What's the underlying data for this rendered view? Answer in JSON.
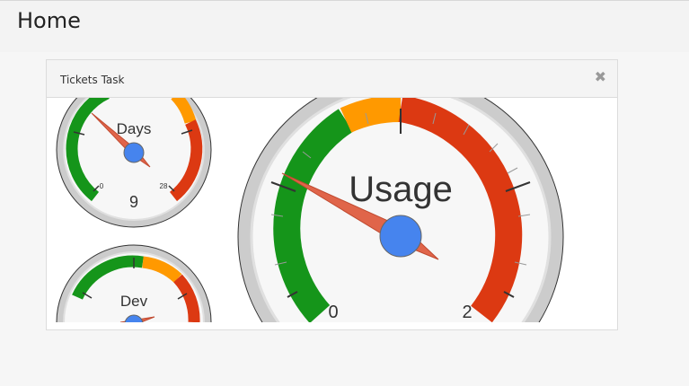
{
  "page": {
    "title": "Home"
  },
  "panel": {
    "title": "Tickets Task",
    "close_icon": "close-icon"
  },
  "gauges": {
    "days": {
      "label": "Days",
      "value": "9",
      "min": "0",
      "max": "28"
    },
    "dev": {
      "label": "Dev"
    },
    "usage": {
      "label": "Usage",
      "min": "0",
      "max": "2"
    }
  },
  "colors": {
    "green": "#15951a",
    "orange": "#ff9900",
    "red": "#dc3912",
    "needle": "#e0654a",
    "hub": "#4684ee"
  }
}
